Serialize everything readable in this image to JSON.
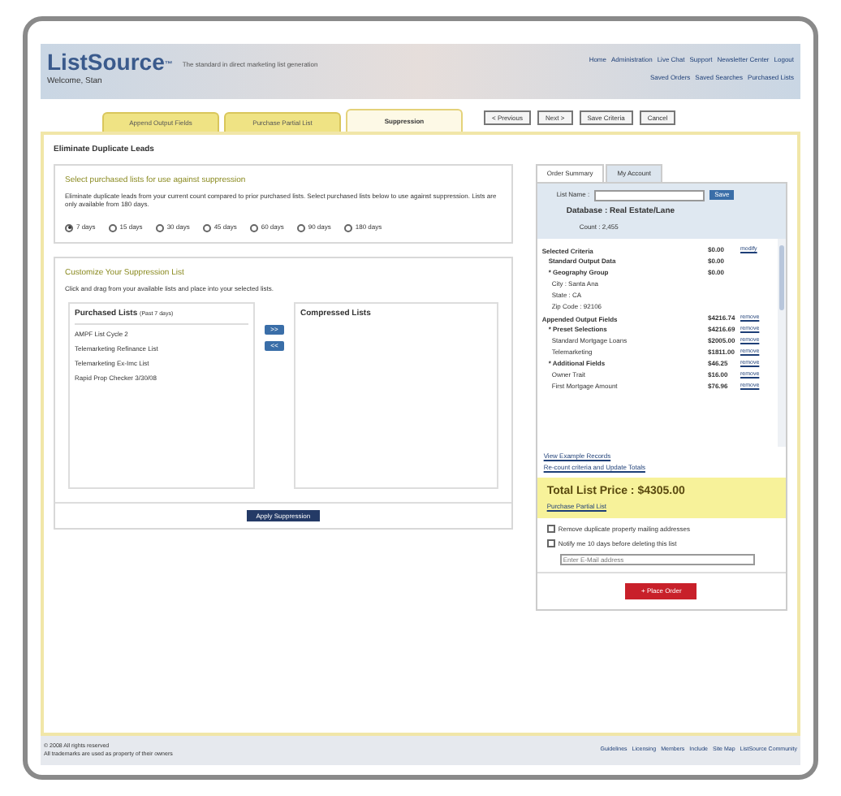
{
  "header": {
    "logo": "ListSource",
    "trademark": "™",
    "tagline": "The standard in direct marketing list generation",
    "welcome": "Welcome, Stan",
    "links_top": [
      "Home",
      "Administration",
      "Live Chat",
      "Support",
      "Newsletter Center",
      "Logout"
    ],
    "links_bottom": [
      "Saved Orders",
      "Saved Searches",
      "Purchased Lists"
    ]
  },
  "tabs": [
    {
      "label": "Append Output Fields",
      "selected": false
    },
    {
      "label": "Purchase Partial List",
      "selected": false
    },
    {
      "label": "Suppression",
      "selected": true
    }
  ],
  "nav_buttons": [
    "< Previous",
    "Next >",
    "Save Criteria",
    "Cancel"
  ],
  "section_title": "Eliminate Duplicate Leads",
  "select_box": {
    "heading": "Select purchased lists for use against suppression",
    "text": "Eliminate duplicate leads from your current count compared to prior purchased lists. Select purchased lists below to use against suppression. Lists are only available from 180 days.",
    "options": [
      {
        "label": "7 days",
        "selected": true
      },
      {
        "label": "15 days",
        "selected": false
      },
      {
        "label": "30 days",
        "selected": false
      },
      {
        "label": "45 days",
        "selected": false
      },
      {
        "label": "60 days",
        "selected": false
      },
      {
        "label": "90 days",
        "selected": false
      },
      {
        "label": "180 days",
        "selected": false
      }
    ]
  },
  "customize_box": {
    "heading": "Customize Your Suppression List",
    "text": "Click and drag from your available lists and place into your selected lists.",
    "purchased": {
      "title": "Purchased Lists",
      "note": "(Past 7 days)",
      "items": [
        "AMPF List Cycle 2",
        "Telemarketing Refinance List",
        "Telemarketing Ex-Imc List",
        "Rapid Prop Checker 3/30/08"
      ]
    },
    "move_buttons": [
      ">>",
      "<<"
    ],
    "compressed": {
      "title": "Compressed Lists"
    },
    "apply_button": "Apply Suppression"
  },
  "summary": {
    "tabs": [
      {
        "label": "Order Summary",
        "selected": true
      },
      {
        "label": "My Account",
        "selected": false
      }
    ],
    "list_name_label": "List Name :",
    "save_button": "Save",
    "database": "Database : Real Estate/Lane",
    "count": "Count : 2,455",
    "rows": [
      {
        "kind": "section",
        "label": "Selected Criteria",
        "price": "$0.00",
        "action": "modify"
      },
      {
        "kind": "bold",
        "label": "Standard Output Data",
        "price": "$0.00"
      },
      {
        "kind": "bold",
        "label": "* Geography Group",
        "price": "$0.00"
      },
      {
        "kind": "item",
        "label": "City : Santa Ana"
      },
      {
        "kind": "item",
        "label": "State : CA"
      },
      {
        "kind": "item",
        "label": "Zip Code : 92106"
      },
      {
        "kind": "section",
        "label": "Appended Output Fields",
        "price": "$4216.74",
        "action": "remove"
      },
      {
        "kind": "bold",
        "label": "* Preset Selections",
        "price": "$4216.69",
        "action": "remove"
      },
      {
        "kind": "item",
        "label": "Standard Mortgage Loans",
        "price": "$2005.00",
        "action": "remove"
      },
      {
        "kind": "item",
        "label": "Telemarketing",
        "price": "$1811.00",
        "action": "remove"
      },
      {
        "kind": "bold",
        "label": "* Additional Fields",
        "price": "$46.25",
        "action": "remove"
      },
      {
        "kind": "item",
        "label": "Owner Trait",
        "price": "$16.00",
        "action": "remove"
      },
      {
        "kind": "item",
        "label": "First Mortgage Amount",
        "price": "$76.96",
        "action": "remove"
      }
    ],
    "links": [
      "View Example Records",
      "Re-count criteria and Update Totals"
    ],
    "total": "Total List Price : $4305.00",
    "partial_link": "Purchase Partial List",
    "options": [
      {
        "label": "Remove duplicate property mailing addresses",
        "checked": false
      },
      {
        "label": "Notify me 10 days before deleting this list",
        "checked": false
      }
    ],
    "email_placeholder": "Enter E-Mail address",
    "place_order": "+ Place Order"
  },
  "footer": {
    "lines": [
      "© 2008 All rights reserved",
      "All trademarks are used as property of their owners"
    ],
    "links": [
      "Guidelines",
      "Licensing",
      "Members",
      "Include",
      "Site Map",
      "ListSource Community"
    ]
  }
}
